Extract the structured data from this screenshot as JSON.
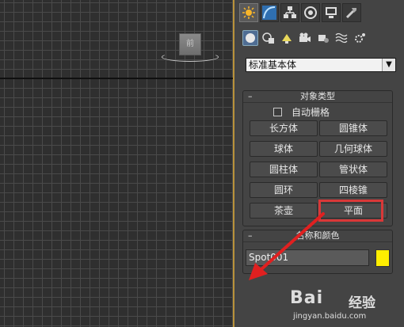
{
  "viewport": {
    "viewcube_label": "前"
  },
  "panel": {
    "tabs": [
      "create-icon",
      "modify-icon",
      "hierarchy-icon",
      "motion-icon",
      "display-icon",
      "utilities-icon"
    ],
    "subicons": [
      "geometry-icon",
      "shapes-icon",
      "lights-icon",
      "cameras-icon",
      "helpers-icon",
      "spacewarps-icon",
      "systems-icon"
    ],
    "category": "标准基本体",
    "object_type": {
      "title": "对象类型",
      "collapse_symbol": "–",
      "autogrid_label": "自动栅格",
      "buttons": [
        "长方体",
        "圆锥体",
        "球体",
        "几何球体",
        "圆柱体",
        "管状体",
        "圆环",
        "四棱锥",
        "茶壶",
        "平面"
      ]
    },
    "name_color": {
      "title": "名称和颜色",
      "collapse_symbol": "–",
      "name_value": "Spot001",
      "swatch_color": "#ffee00"
    }
  },
  "watermark": {
    "brand": "Bai",
    "brand_suffix": "经验",
    "url": "jingyan.baidu.com"
  },
  "colors": {
    "highlight": "#d93838",
    "viewport_border": "#b9923a"
  }
}
